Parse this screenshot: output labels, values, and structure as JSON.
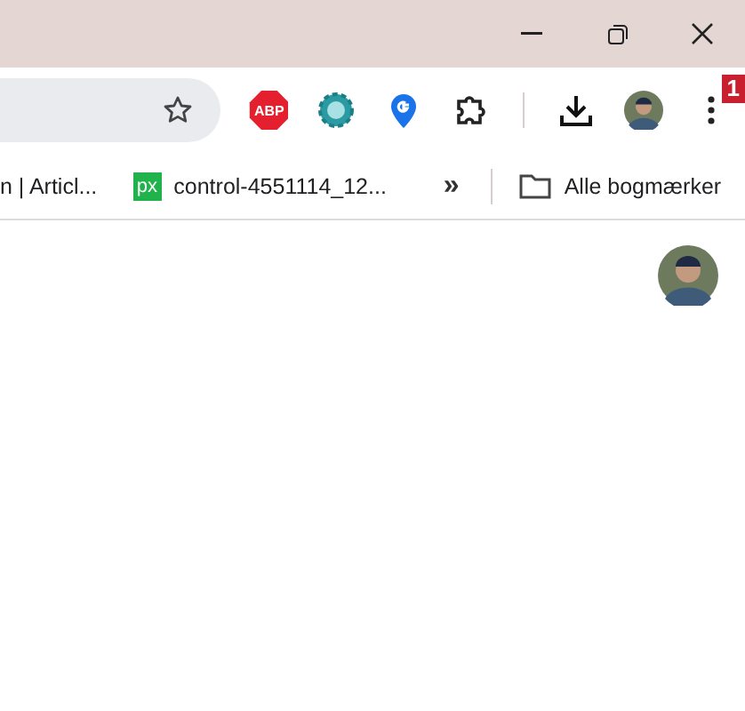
{
  "toolbar": {
    "extensions": [
      {
        "kind": "abp",
        "label": "ABP"
      },
      {
        "kind": "gear"
      },
      {
        "kind": "g"
      },
      {
        "kind": "puzzle"
      }
    ],
    "menu_badge": "1"
  },
  "bookmarks": [
    {
      "kind": "plain",
      "label": "n | Articl..."
    },
    {
      "kind": "px",
      "icon_text": "px",
      "label": "control-4551114_12..."
    }
  ],
  "bookmarks_overflow": "»",
  "all_bookmarks": "Alle bogmærker"
}
